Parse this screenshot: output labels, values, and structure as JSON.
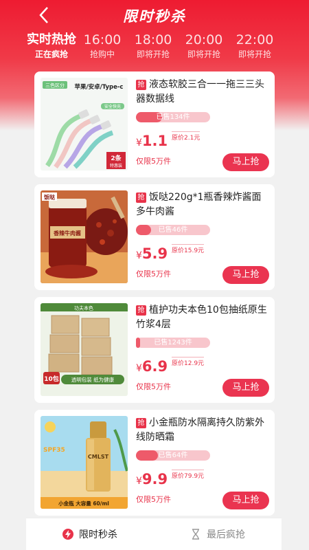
{
  "header": {
    "title": "限时秒杀"
  },
  "time_slots": [
    {
      "time": "实时热抢",
      "status": "正在疯抢",
      "active": true
    },
    {
      "time": "16:00",
      "status": "抢购中",
      "active": false
    },
    {
      "time": "18:00",
      "status": "即将开抢",
      "active": false
    },
    {
      "time": "20:00",
      "status": "即将开抢",
      "active": false
    },
    {
      "time": "22:00",
      "status": "即将开抢",
      "active": false
    }
  ],
  "products": [
    {
      "tag": "抢",
      "name": "液态软胶三合一一拖三三头器数据线",
      "sold": "已售134件",
      "sold_ratio": 0.35,
      "yen": "¥",
      "price": "1.1",
      "original_price": "原价2.1元",
      "limit": "仅限5万件",
      "button": "马上抢",
      "image_text": {
        "badge": "三色区分",
        "headline": "苹果/安卓/Type-c",
        "sub": "安全快充",
        "corner": "2条",
        "corner_sub": "特惠装"
      }
    },
    {
      "tag": "抢",
      "name": "饭哒220g*1瓶香辣炸酱面多牛肉酱",
      "sold": "已售46件",
      "sold_ratio": 0.2,
      "yen": "¥",
      "price": "5.9",
      "original_price": "原价15.9元",
      "limit": "仅限5万件",
      "button": "马上抢",
      "image_text": {
        "badge": "饭哒",
        "label": "香辣牛肉酱"
      }
    },
    {
      "tag": "抢",
      "name": "植护功夫本色10包抽纸原生竹浆4层",
      "sold": "已售1243件",
      "sold_ratio": 0.06,
      "yen": "¥",
      "price": "6.9",
      "original_price": "原价12.9元",
      "limit": "仅限5万件",
      "button": "马上抢",
      "image_text": {
        "badge": "功夫本色",
        "count": "10包",
        "bottom": "透明包装 纸为健康"
      }
    },
    {
      "tag": "抢",
      "name": "小金瓶防水隔离持久防紫外线防晒霜",
      "sold": "已售64件",
      "sold_ratio": 0.3,
      "yen": "¥",
      "price": "9.9",
      "original_price": "原价79.9元",
      "limit": "仅限5万件",
      "button": "马上抢",
      "image_text": {
        "spf": "SPF35",
        "brand": "CMLST",
        "bottom": "小金瓶 大容量 60/ml"
      }
    }
  ],
  "tabbar": {
    "items": [
      {
        "label": "限时秒杀",
        "icon": "lightning-icon",
        "active": true
      },
      {
        "label": "最后疯抢",
        "icon": "hourglass-icon",
        "active": false
      }
    ]
  },
  "colors": {
    "accent": "#e8334a",
    "header_red": "#ee1b31",
    "sold_bg": "#f8c6cc"
  }
}
